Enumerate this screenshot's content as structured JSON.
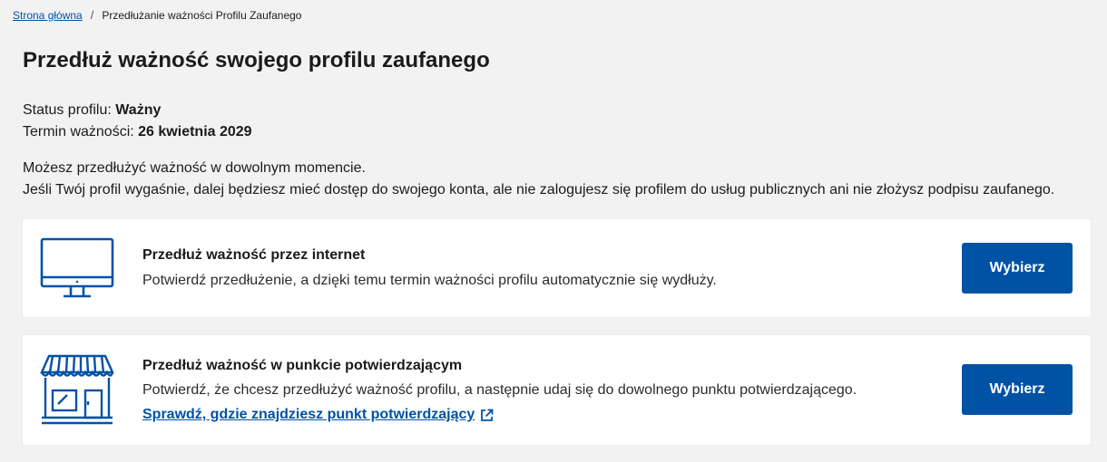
{
  "breadcrumb": {
    "home": "Strona główna",
    "separator": "/",
    "current": "Przedłużanie ważności Profilu Zaufanego"
  },
  "page_title": "Przedłuż ważność swojego profilu zaufanego",
  "status": {
    "status_label": "Status profilu:",
    "status_value": "Ważny",
    "expiry_label": "Termin ważności:",
    "expiry_value": "26 kwietnia 2029"
  },
  "description": {
    "line1": "Możesz przedłużyć ważność w dowolnym momencie.",
    "line2": "Jeśli Twój profil wygaśnie, dalej będziesz mieć dostęp do swojego konta, ale nie zalogujesz się profilem do usług publicznych ani nie złożysz podpisu zaufanego."
  },
  "options": [
    {
      "icon": "computer-monitor-icon",
      "title": "Przedłuż ważność przez internet",
      "body": "Potwierdź przedłużenie, a dzięki temu termin ważności profilu automatycznie się wydłuży.",
      "button": "Wybierz"
    },
    {
      "icon": "storefront-icon",
      "title": "Przedłuż ważność w punkcie potwierdzającym",
      "body": "Potwierdź, że chcesz przedłużyć ważność profilu, a następnie udaj się do dowolnego punktu potwierdzającego.",
      "link": "Sprawdź, gdzie znajdziesz punkt potwierdzający",
      "link_icon": "external-link-icon",
      "button": "Wybierz"
    }
  ],
  "colors": {
    "primary": "#0052a5",
    "background": "#f2f2f2",
    "card": "#ffffff",
    "text": "#1b1b1b"
  }
}
